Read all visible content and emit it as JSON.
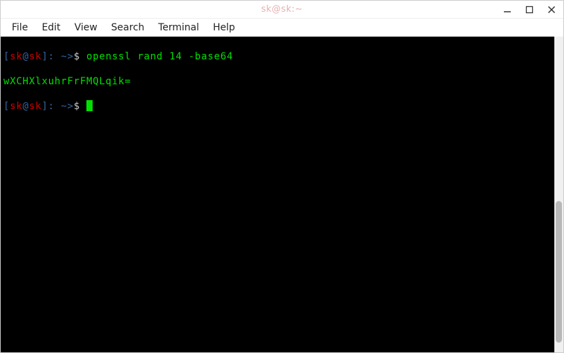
{
  "window": {
    "title": "sk@sk:~"
  },
  "menus": {
    "file": "File",
    "edit": "Edit",
    "view": "View",
    "search": "Search",
    "terminal": "Terminal",
    "help": "Help"
  },
  "icons": {
    "minimize": "minimize-icon",
    "maximize": "maximize-icon",
    "close": "close-icon"
  },
  "terminal": {
    "prompt": {
      "open_bracket": "[",
      "user": "sk",
      "at": "@",
      "host": "sk",
      "close_bracket_path": "]: ~>",
      "dollar": "$ "
    },
    "line1_command": "openssl rand 14 -base64",
    "line2_output": "wXCHXlxuhrFrFMQLqik="
  },
  "scrollbar": {
    "thumb_top_pct": 52,
    "thumb_height_pct": 45
  }
}
